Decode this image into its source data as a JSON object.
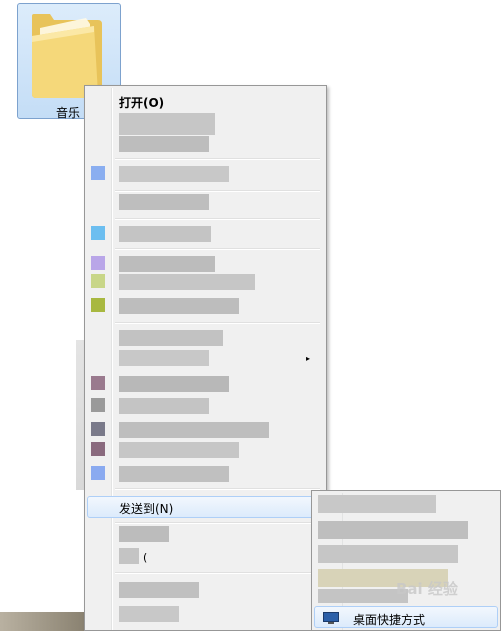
{
  "desktop": {
    "folder_label": "音乐"
  },
  "context_menu": {
    "open_label": "打开(O)",
    "send_to_label": "发送到(N)",
    "partial_hotkey": "(",
    "submenu_arrow": "▸"
  },
  "send_to_submenu": {
    "desktop_shortcut_label": "桌面快捷方式"
  },
  "watermark": {
    "text": "Bai 经验"
  },
  "colors": {
    "menu_bg": "#f0f0f0",
    "hover_bg": "#dcebfc",
    "hover_border": "#aecff7",
    "folder_select": "#cde3f8"
  }
}
